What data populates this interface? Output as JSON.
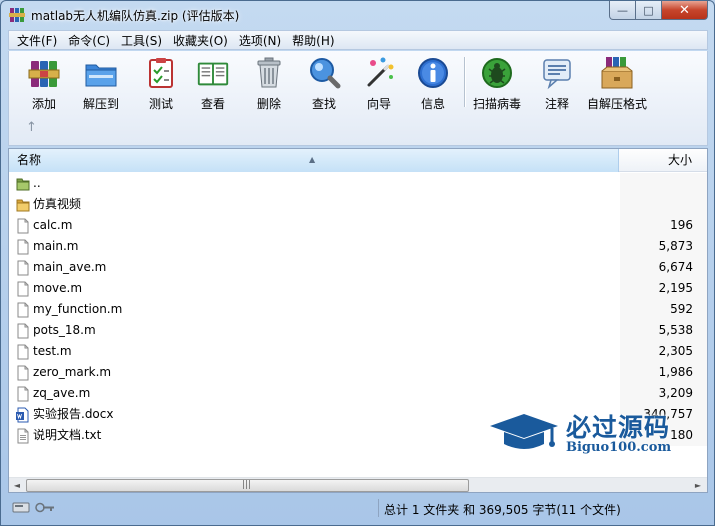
{
  "window": {
    "title": "matlab无人机编队仿真.zip (评估版本)"
  },
  "caption": {
    "minimize": "—",
    "maximize": "□",
    "close": "✕"
  },
  "menu": [
    "文件(F)",
    "命令(C)",
    "工具(S)",
    "收藏夹(O)",
    "选项(N)",
    "帮助(H)"
  ],
  "toolbar": {
    "add": "添加",
    "extract": "解压到",
    "test": "测试",
    "view": "查看",
    "delete": "删除",
    "find": "查找",
    "wizard": "向导",
    "info": "信息",
    "scan": "扫描病毒",
    "comment": "注释",
    "sfx": "自解压格式",
    "up": "↑"
  },
  "list": {
    "col_name": "名称",
    "col_size": "大小",
    "sort_arrow": "▲",
    "rows": [
      {
        "name": "..",
        "size": "",
        "kind": "parent"
      },
      {
        "name": "仿真视频",
        "size": "",
        "kind": "folder"
      },
      {
        "name": "calc.m",
        "size": "196",
        "kind": "file"
      },
      {
        "name": "main.m",
        "size": "5,873",
        "kind": "file"
      },
      {
        "name": "main_ave.m",
        "size": "6,674",
        "kind": "file"
      },
      {
        "name": "move.m",
        "size": "2,195",
        "kind": "file"
      },
      {
        "name": "my_function.m",
        "size": "592",
        "kind": "file"
      },
      {
        "name": "pots_18.m",
        "size": "5,538",
        "kind": "file"
      },
      {
        "name": "test.m",
        "size": "2,305",
        "kind": "file"
      },
      {
        "name": "zero_mark.m",
        "size": "1,986",
        "kind": "file"
      },
      {
        "name": "zq_ave.m",
        "size": "3,209",
        "kind": "file"
      },
      {
        "name": "实验报告.docx",
        "size": "340,757",
        "kind": "docx"
      },
      {
        "name": "说明文档.txt",
        "size": "180",
        "kind": "file"
      }
    ]
  },
  "scrollbar": {
    "left": "◄",
    "right": "►",
    "grip": "|||"
  },
  "status": {
    "summary": "总计 1 文件夹 和 369,505 字节(11 个文件)"
  },
  "watermark": {
    "cn": "必过源码",
    "en": "Biguo100.com"
  },
  "colors": {
    "accent": "#1a5a9c",
    "folder": "#e8b84a",
    "close": "#c7452c"
  }
}
